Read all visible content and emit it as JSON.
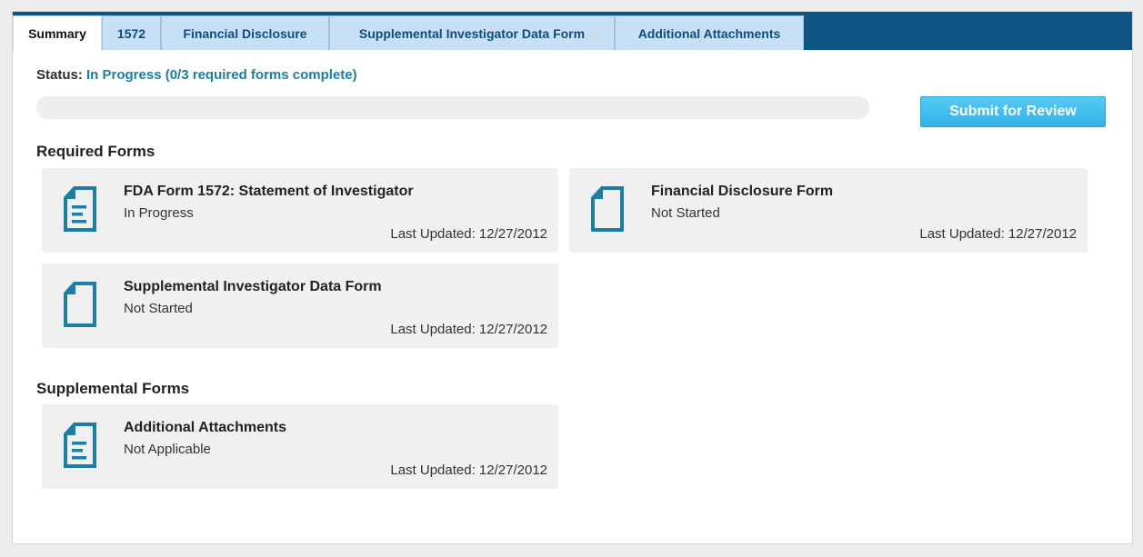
{
  "tabs": [
    {
      "label": "Summary"
    },
    {
      "label": "1572"
    },
    {
      "label": "Financial Disclosure"
    },
    {
      "label": "Supplemental Investigator Data Form"
    },
    {
      "label": "Additional Attachments"
    }
  ],
  "status": {
    "label": "Status:",
    "value": "In Progress (0/3 required forms complete)",
    "progress_percent": 0
  },
  "submit_button": {
    "label": "Submit for Review"
  },
  "required_section": {
    "title": "Required Forms"
  },
  "supplemental_section": {
    "title": "Supplemental Forms"
  },
  "required_forms": [
    {
      "title": "FDA Form 1572: Statement of Investigator",
      "status": "In Progress",
      "updated": "Last Updated: 12/27/2012",
      "icon": "document-lines-icon"
    },
    {
      "title": "Financial Disclosure Form",
      "status": "Not Started",
      "updated": "Last Updated: 12/27/2012",
      "icon": "document-blank-icon"
    },
    {
      "title": "Supplemental Investigator Data Form",
      "status": "Not Started",
      "updated": "Last Updated: 12/27/2012",
      "icon": "document-blank-icon"
    }
  ],
  "supplemental_forms": [
    {
      "title": "Additional Attachments",
      "status": "Not Applicable",
      "updated": "Last Updated: 12/27/2012",
      "icon": "document-lines-icon"
    }
  ],
  "colors": {
    "tab_bar": "#0e5584",
    "tab_inactive": "#c8e0f5",
    "accent": "#1b7ea5",
    "icon": "#1b7ea5",
    "button": "#31b3e8"
  }
}
